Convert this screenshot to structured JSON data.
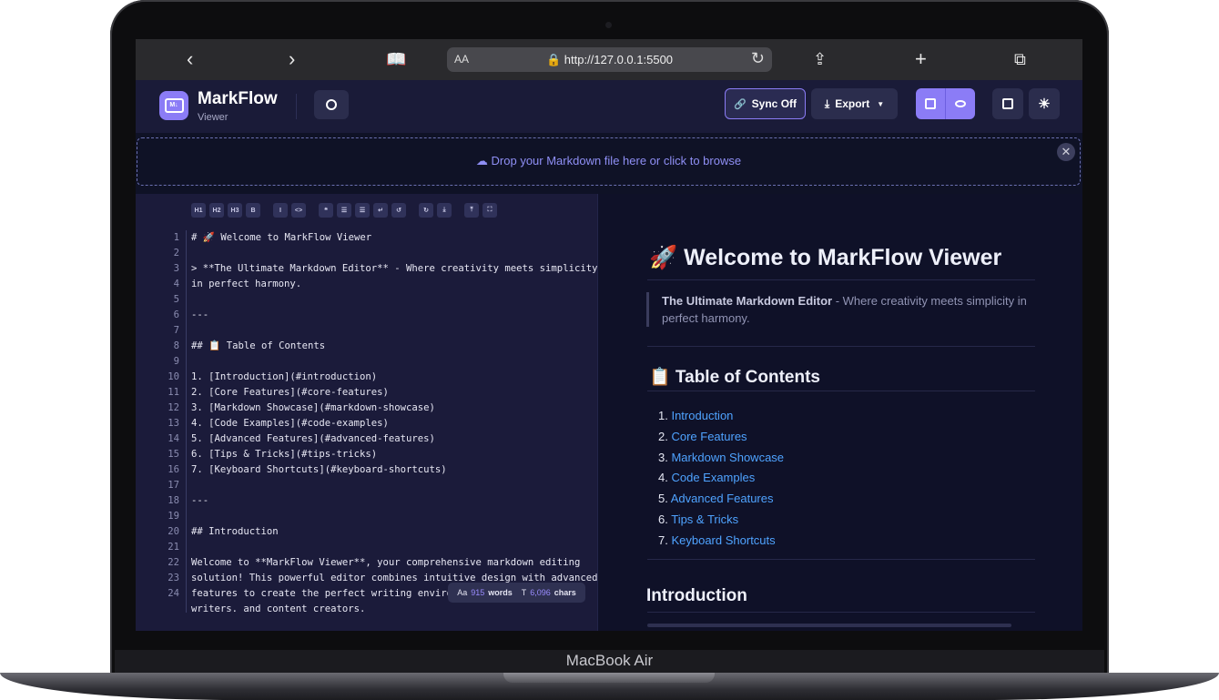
{
  "device": {
    "brand": "MacBook Air"
  },
  "browser": {
    "text_size_label": "AA",
    "url": "http://127.0.0.1:5500"
  },
  "app": {
    "name": "MarkFlow",
    "subtitle": "Viewer",
    "logo_text": "M↓",
    "buttons": {
      "sync": "Sync Off",
      "export": "Export"
    },
    "accent": "#8b7cf6"
  },
  "dropzone": {
    "text": "Drop your Markdown file here or click to browse"
  },
  "toolbar": [
    "H1",
    "H2",
    "H3",
    "B",
    "I",
    "<>",
    "❝",
    "☰",
    "☰",
    "↵",
    "↺",
    "↻",
    "⤓",
    "⤒",
    "⛶"
  ],
  "editor": {
    "lines": [
      {
        "n": "1",
        "t": "# 🚀 Welcome to MarkFlow Viewer"
      },
      {
        "n": "2",
        "t": ""
      },
      {
        "n": "3",
        "t": "> **The Ultimate Markdown Editor** - Where creativity meets simplicity"
      },
      {
        "n": "4",
        "t": "in perfect harmony."
      },
      {
        "n": "5",
        "t": ""
      },
      {
        "n": "6",
        "t": "---"
      },
      {
        "n": "7",
        "t": ""
      },
      {
        "n": "8",
        "t": "## 📋 Table of Contents"
      },
      {
        "n": "9",
        "t": ""
      },
      {
        "n": "10",
        "t": "1. [Introduction](#introduction)"
      },
      {
        "n": "11",
        "t": "2. [Core Features](#core-features)"
      },
      {
        "n": "12",
        "t": "3. [Markdown Showcase](#markdown-showcase)"
      },
      {
        "n": "13",
        "t": "4. [Code Examples](#code-examples)"
      },
      {
        "n": "14",
        "t": "5. [Advanced Features](#advanced-features)"
      },
      {
        "n": "15",
        "t": "6. [Tips & Tricks](#tips-tricks)"
      },
      {
        "n": "16",
        "t": "7. [Keyboard Shortcuts](#keyboard-shortcuts)"
      },
      {
        "n": "17",
        "t": ""
      },
      {
        "n": "18",
        "t": "---"
      },
      {
        "n": "19",
        "t": ""
      },
      {
        "n": "20",
        "t": "## Introduction"
      },
      {
        "n": "21",
        "t": ""
      },
      {
        "n": "22",
        "t": "Welcome to **MarkFlow Viewer**, your comprehensive markdown editing"
      },
      {
        "n": "23",
        "t": "solution! This powerful editor combines intuitive design with advanced"
      },
      {
        "n": "24",
        "t": "features to create the perfect writing environment for developers,"
      },
      {
        "n": "",
        "t": "writers. and content creators."
      }
    ],
    "stats": {
      "words": "915",
      "words_label": "words",
      "chars": "6,096",
      "chars_label": "chars",
      "words_icon": "Aa",
      "chars_icon": "T"
    }
  },
  "preview": {
    "h1": "🚀 Welcome to MarkFlow Viewer",
    "quote_bold": "The Ultimate Markdown Editor",
    "quote_rest": " - Where creativity meets simplicity in perfect harmony.",
    "toc_heading": "📋 Table of Contents",
    "toc": [
      {
        "num": "1.",
        "label": "Introduction"
      },
      {
        "num": "2.",
        "label": "Core Features"
      },
      {
        "num": "3.",
        "label": "Markdown Showcase"
      },
      {
        "num": "4.",
        "label": "Code Examples"
      },
      {
        "num": "5.",
        "label": "Advanced Features"
      },
      {
        "num": "6.",
        "label": "Tips & Tricks"
      },
      {
        "num": "7.",
        "label": "Keyboard Shortcuts"
      }
    ],
    "section_heading": "Introduction"
  }
}
